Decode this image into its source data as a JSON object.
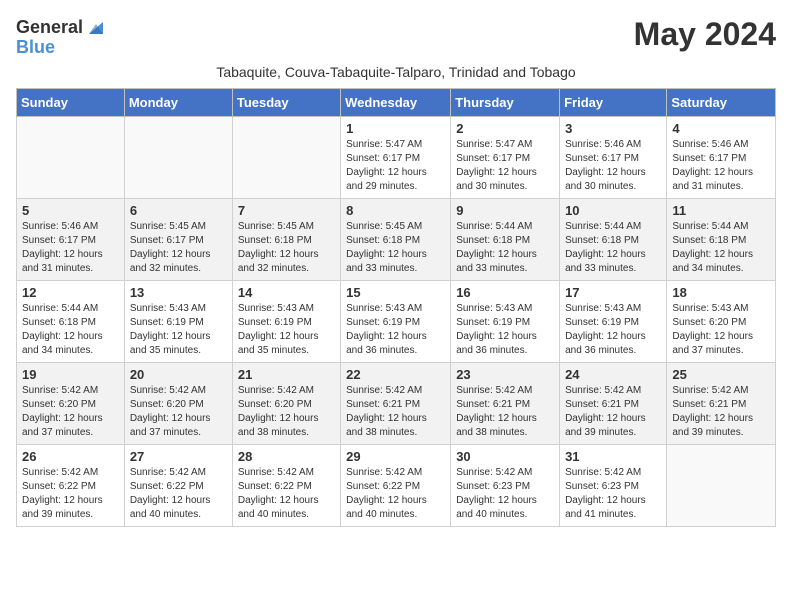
{
  "logo": {
    "general": "General",
    "blue": "Blue"
  },
  "title": "May 2024",
  "subtitle": "Tabaquite, Couva-Tabaquite-Talparo, Trinidad and Tobago",
  "days_of_week": [
    "Sunday",
    "Monday",
    "Tuesday",
    "Wednesday",
    "Thursday",
    "Friday",
    "Saturday"
  ],
  "weeks": [
    [
      {
        "day": "",
        "info": ""
      },
      {
        "day": "",
        "info": ""
      },
      {
        "day": "",
        "info": ""
      },
      {
        "day": "1",
        "info": "Sunrise: 5:47 AM\nSunset: 6:17 PM\nDaylight: 12 hours and 29 minutes."
      },
      {
        "day": "2",
        "info": "Sunrise: 5:47 AM\nSunset: 6:17 PM\nDaylight: 12 hours and 30 minutes."
      },
      {
        "day": "3",
        "info": "Sunrise: 5:46 AM\nSunset: 6:17 PM\nDaylight: 12 hours and 30 minutes."
      },
      {
        "day": "4",
        "info": "Sunrise: 5:46 AM\nSunset: 6:17 PM\nDaylight: 12 hours and 31 minutes."
      }
    ],
    [
      {
        "day": "5",
        "info": "Sunrise: 5:46 AM\nSunset: 6:17 PM\nDaylight: 12 hours and 31 minutes."
      },
      {
        "day": "6",
        "info": "Sunrise: 5:45 AM\nSunset: 6:17 PM\nDaylight: 12 hours and 32 minutes."
      },
      {
        "day": "7",
        "info": "Sunrise: 5:45 AM\nSunset: 6:18 PM\nDaylight: 12 hours and 32 minutes."
      },
      {
        "day": "8",
        "info": "Sunrise: 5:45 AM\nSunset: 6:18 PM\nDaylight: 12 hours and 33 minutes."
      },
      {
        "day": "9",
        "info": "Sunrise: 5:44 AM\nSunset: 6:18 PM\nDaylight: 12 hours and 33 minutes."
      },
      {
        "day": "10",
        "info": "Sunrise: 5:44 AM\nSunset: 6:18 PM\nDaylight: 12 hours and 33 minutes."
      },
      {
        "day": "11",
        "info": "Sunrise: 5:44 AM\nSunset: 6:18 PM\nDaylight: 12 hours and 34 minutes."
      }
    ],
    [
      {
        "day": "12",
        "info": "Sunrise: 5:44 AM\nSunset: 6:18 PM\nDaylight: 12 hours and 34 minutes."
      },
      {
        "day": "13",
        "info": "Sunrise: 5:43 AM\nSunset: 6:19 PM\nDaylight: 12 hours and 35 minutes."
      },
      {
        "day": "14",
        "info": "Sunrise: 5:43 AM\nSunset: 6:19 PM\nDaylight: 12 hours and 35 minutes."
      },
      {
        "day": "15",
        "info": "Sunrise: 5:43 AM\nSunset: 6:19 PM\nDaylight: 12 hours and 36 minutes."
      },
      {
        "day": "16",
        "info": "Sunrise: 5:43 AM\nSunset: 6:19 PM\nDaylight: 12 hours and 36 minutes."
      },
      {
        "day": "17",
        "info": "Sunrise: 5:43 AM\nSunset: 6:19 PM\nDaylight: 12 hours and 36 minutes."
      },
      {
        "day": "18",
        "info": "Sunrise: 5:43 AM\nSunset: 6:20 PM\nDaylight: 12 hours and 37 minutes."
      }
    ],
    [
      {
        "day": "19",
        "info": "Sunrise: 5:42 AM\nSunset: 6:20 PM\nDaylight: 12 hours and 37 minutes."
      },
      {
        "day": "20",
        "info": "Sunrise: 5:42 AM\nSunset: 6:20 PM\nDaylight: 12 hours and 37 minutes."
      },
      {
        "day": "21",
        "info": "Sunrise: 5:42 AM\nSunset: 6:20 PM\nDaylight: 12 hours and 38 minutes."
      },
      {
        "day": "22",
        "info": "Sunrise: 5:42 AM\nSunset: 6:21 PM\nDaylight: 12 hours and 38 minutes."
      },
      {
        "day": "23",
        "info": "Sunrise: 5:42 AM\nSunset: 6:21 PM\nDaylight: 12 hours and 38 minutes."
      },
      {
        "day": "24",
        "info": "Sunrise: 5:42 AM\nSunset: 6:21 PM\nDaylight: 12 hours and 39 minutes."
      },
      {
        "day": "25",
        "info": "Sunrise: 5:42 AM\nSunset: 6:21 PM\nDaylight: 12 hours and 39 minutes."
      }
    ],
    [
      {
        "day": "26",
        "info": "Sunrise: 5:42 AM\nSunset: 6:22 PM\nDaylight: 12 hours and 39 minutes."
      },
      {
        "day": "27",
        "info": "Sunrise: 5:42 AM\nSunset: 6:22 PM\nDaylight: 12 hours and 40 minutes."
      },
      {
        "day": "28",
        "info": "Sunrise: 5:42 AM\nSunset: 6:22 PM\nDaylight: 12 hours and 40 minutes."
      },
      {
        "day": "29",
        "info": "Sunrise: 5:42 AM\nSunset: 6:22 PM\nDaylight: 12 hours and 40 minutes."
      },
      {
        "day": "30",
        "info": "Sunrise: 5:42 AM\nSunset: 6:23 PM\nDaylight: 12 hours and 40 minutes."
      },
      {
        "day": "31",
        "info": "Sunrise: 5:42 AM\nSunset: 6:23 PM\nDaylight: 12 hours and 41 minutes."
      },
      {
        "day": "",
        "info": ""
      }
    ]
  ]
}
